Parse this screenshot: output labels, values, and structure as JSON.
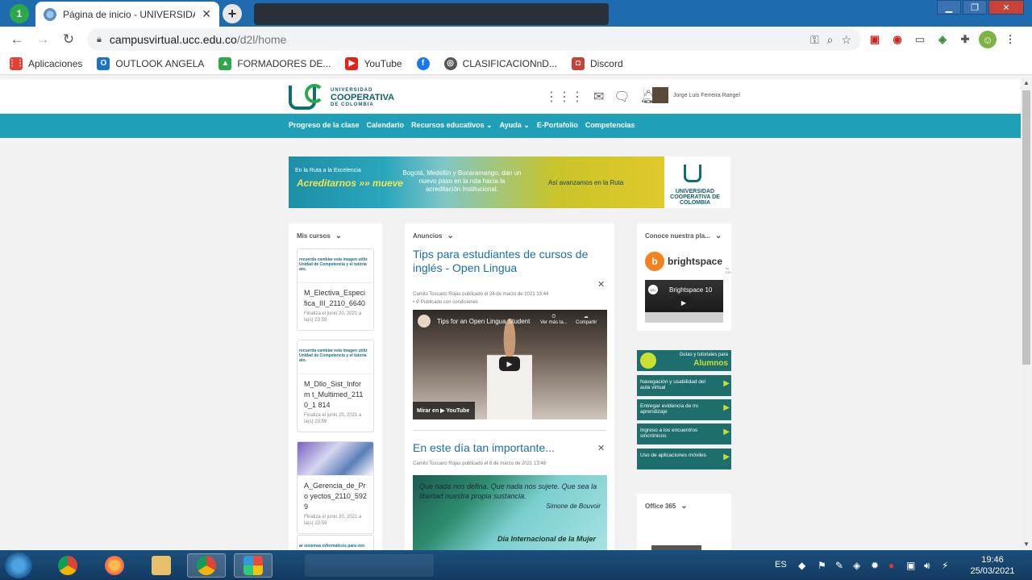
{
  "browser": {
    "tab_count_badge": "1",
    "active_tab_title": "Página de inicio - UNIVERSIDAD",
    "new_tab_label": "+",
    "url_host": "campusvirtual.ucc.edu.co",
    "url_path": "/d2l/home",
    "window": {
      "minimize": "▁",
      "restore": "❐",
      "close": "✕"
    }
  },
  "bookmarks": [
    {
      "label": "Aplicaciones",
      "color": "#e34133",
      "glyph": "⋮⋮"
    },
    {
      "label": "OUTLOOK ANGELA",
      "color": "#1a73c8",
      "glyph": "O"
    },
    {
      "label": "FORMADORES DE...",
      "color": "#2aa84a",
      "glyph": "▲"
    },
    {
      "label": "YouTube",
      "color": "#e62117",
      "glyph": "▶"
    },
    {
      "label": "",
      "color": "#1877f2",
      "glyph": "f"
    },
    {
      "label": "CLASIFICACIONnD...",
      "color": "#555555",
      "glyph": "◎"
    },
    {
      "label": "Discord",
      "color": "#c94234",
      "glyph": "◘"
    }
  ],
  "site": {
    "logo_line1": "UNIVERSIDAD",
    "logo_line2": "COOPERATIVA",
    "logo_line3": "DE COLOMBIA",
    "user_name": "Jorge Luis Ferreira Rangel",
    "nav": [
      "Progreso de la clase",
      "Calendario",
      "Recursos educativos ⌄",
      "Ayuda ⌄",
      "E-Portafolio",
      "Competencias"
    ],
    "banner": {
      "kicker": "En la Ruta a la Excelencia",
      "slogan": "Acreditarnos »» mueve",
      "message": "Bogotá, Medellín y Bucaramango, dan un nuevo paso en la ruta hacia la acreditación Institucional.",
      "cta": "Así avanzamos en la Ruta",
      "logo_text": "UNIVERSIDAD COOPERATIVA DE COLOMBIA"
    }
  },
  "my_courses": {
    "title": "Mis cursos",
    "items": [
      {
        "banner": "recuerda cambiar esta imagen utiliz Unidad de Competencia y el tutoria ato.",
        "name": "M_Electiva_Especifica_III_2110_6640",
        "due": "Finaliza el junio 20, 2021 a la(s) 23:59"
      },
      {
        "banner": "recuerda cambiar esta imagen utiliz Unidad de Competencia y el tutoria ato.",
        "name": "M_Dllo_Sist_Inform t_Multimed_2110_1 814",
        "due": "Finaliza el junio 20, 2021 a la(s) 23:59"
      },
      {
        "banner": "",
        "name": "A_Gerencia_de_Pro yectos_2110_5929",
        "due": "Finaliza el junio 20, 2021 a la(s) 23:59"
      },
      {
        "banner": "ar sistemas informáticos para con",
        "name": "",
        "due": ""
      }
    ]
  },
  "announcements": {
    "title": "Anuncios",
    "items": [
      {
        "title": "Tips para estudiantes de cursos de inglés - Open Lingua",
        "meta": "Camilo Toscano Rojas publicado el 24 de marzo de 2021 13:44",
        "condition": "Publicado con condiciones",
        "video_title": "Tips for an Open Lingua Student",
        "video_later": "Ver más ta...",
        "video_share": "Compartir",
        "video_watch": "Mirar en ▶ YouTube"
      },
      {
        "title": "En este día tan importante...",
        "meta": "Camilo Toscano Rojas publicado el 8 de marzo de 2021 13:48",
        "quote": "Que nada nos defina. Que nada nos sujete. Que sea la libertad nuestra propia sustancia.",
        "quote_author": "Simone de Bouvoir",
        "quote_caption": "Día Internacional de la Mujer"
      }
    ]
  },
  "right_col": {
    "brightspace_title": "Conoce nuestra pla...",
    "brightspace_name": "brightspace",
    "brightspace_sub": "by D2L",
    "video_label": "Brightspace 10",
    "guides_header": "Guías y tutoriales para",
    "guides_header_big": "Alumnos",
    "guides": [
      "Navegación y usabilidad del aula virtual",
      "Entregar evidencia de mi aprendizaje",
      "Ingreso a los encuentros sincrónicos",
      "Uso de aplicaciones móviles"
    ],
    "office_title": "Office 365"
  },
  "taskbar": {
    "lang": "ES",
    "time": "19:46",
    "date": "25/03/2021"
  }
}
